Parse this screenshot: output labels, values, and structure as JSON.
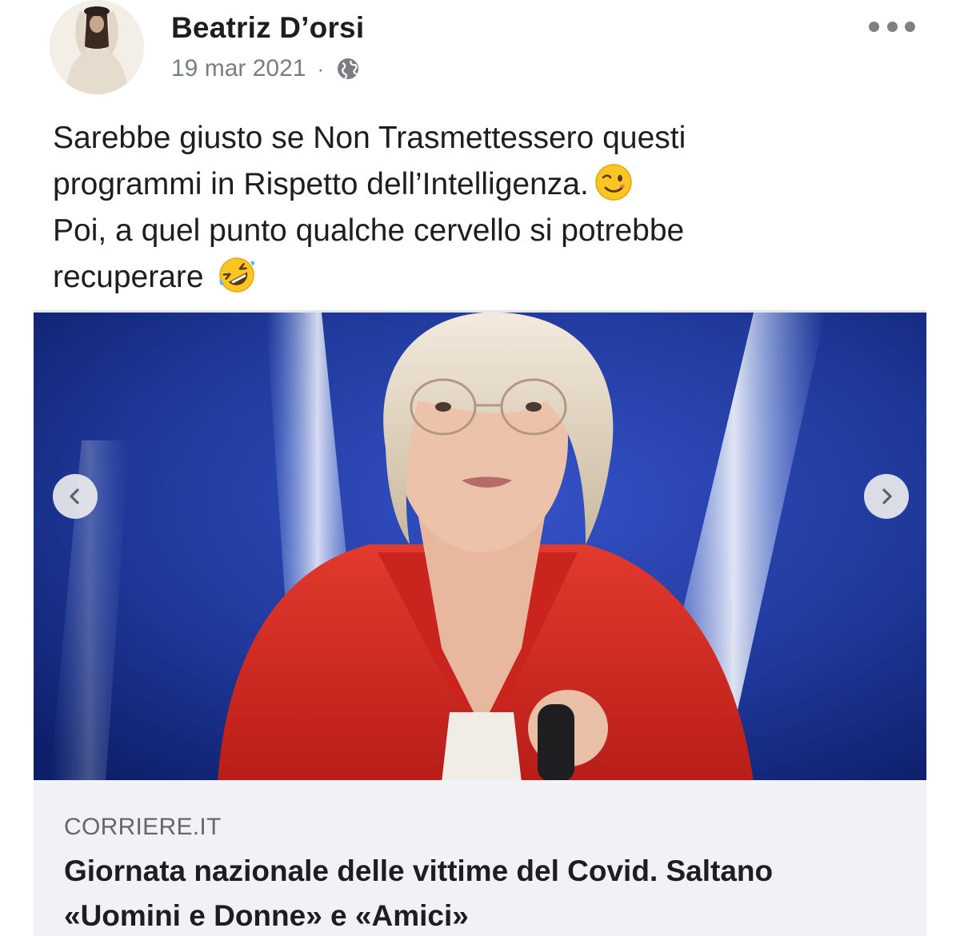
{
  "post": {
    "author": "Beatriz D’orsi",
    "date": "19 mar 2021",
    "separator": "·",
    "privacy_icon": "globe-icon",
    "menu_icon": "more-options-icon",
    "text_lines": [
      "Sarebbe giusto se Non Trasmettessero questi",
      "programmi in Rispetto dell’Intelligenza.",
      "Poi, a quel punto qualche cervello si potrebbe",
      "recuperare"
    ],
    "emojis": [
      "winking-face-emoji",
      "rolling-on-floor-laughing-emoji"
    ]
  },
  "link_card": {
    "image": "photo-of-tv-presenter-in-red-jacket",
    "prev_icon": "chevron-left-icon",
    "next_icon": "chevron-right-icon",
    "domain": "CORRIERE.IT",
    "headline_lines": [
      "Giornata nazionale delle vittime del Covid. Saltano",
      "«Uomini e Donne» e «Amici»"
    ]
  },
  "colors": {
    "text": "#1c1e21",
    "secondary_text": "#65676b",
    "caption_background": "#f0f2f5",
    "image_background": "#1e3a9c"
  }
}
